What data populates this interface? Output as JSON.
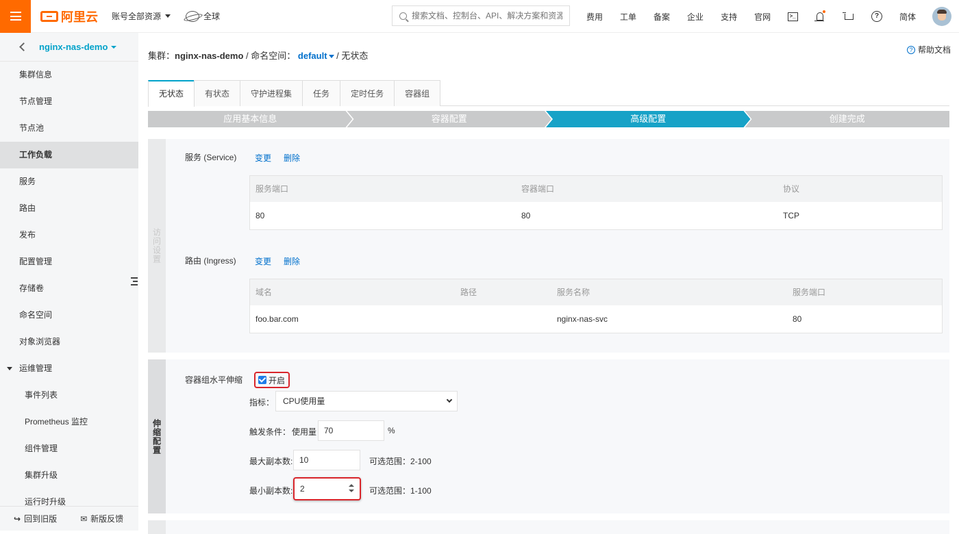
{
  "topbar": {
    "logo_text": "阿里云",
    "account_label": "账号全部资源",
    "region_label": "全球",
    "search_placeholder": "搜索文档、控制台、API、解决方案和资源",
    "nav_links": [
      "费用",
      "工单",
      "备案",
      "企业",
      "支持",
      "官网"
    ],
    "lang_label": "简体",
    "icons": [
      "terminal-icon",
      "bell-icon",
      "cart-icon",
      "help-icon"
    ],
    "notification_dot_color": "#ff6a00",
    "brand_color": "#ff6a00"
  },
  "sidebar": {
    "cluster_name": "nginx-nas-demo",
    "items": [
      {
        "label": "集群信息"
      },
      {
        "label": "节点管理"
      },
      {
        "label": "节点池"
      },
      {
        "label": "工作负载",
        "active": true
      },
      {
        "label": "服务"
      },
      {
        "label": "路由"
      },
      {
        "label": "发布"
      },
      {
        "label": "配置管理"
      },
      {
        "label": "存储卷"
      },
      {
        "label": "命名空间"
      },
      {
        "label": "对象浏览器"
      }
    ],
    "group": {
      "label": "运维管理",
      "expanded": true,
      "children": [
        "事件列表",
        "Prometheus 监控",
        "组件管理",
        "集群升级",
        "运行时升级"
      ]
    },
    "footer": {
      "back_old": "回到旧版",
      "feedback": "新版反馈"
    }
  },
  "main": {
    "breadcrumb": {
      "cluster_prefix": "集群：",
      "cluster": "nginx-nas-demo",
      "sep1": " / ",
      "ns_prefix": "命名空间：",
      "namespace": "default",
      "sep2": " / ",
      "current": "无状态"
    },
    "help_doc": "帮助文档",
    "tabs": [
      {
        "label": "无状态",
        "active": true
      },
      {
        "label": "有状态"
      },
      {
        "label": "守护进程集"
      },
      {
        "label": "任务"
      },
      {
        "label": "定时任务"
      },
      {
        "label": "容器组"
      }
    ],
    "steps": [
      {
        "label": "应用基本信息"
      },
      {
        "label": "容器配置"
      },
      {
        "label": "高级配置",
        "active": true
      },
      {
        "label": "创建完成"
      }
    ],
    "access_panel": {
      "side_label": "访问设置",
      "service": {
        "title": "服务 (Service)",
        "edit": "变更",
        "delete": "删除",
        "columns": [
          "服务端口",
          "容器端口",
          "协议"
        ],
        "rows": [
          [
            "80",
            "80",
            "TCP"
          ]
        ]
      },
      "ingress": {
        "title": "路由 (Ingress)",
        "edit": "变更",
        "delete": "删除",
        "columns": [
          "域名",
          "路径",
          "服务名称",
          "服务端口"
        ],
        "rows": [
          [
            "foo.bar.com",
            "",
            "nginx-nas-svc",
            "80"
          ]
        ]
      }
    },
    "scaling_panel": {
      "side_label": "伸缩配置",
      "hpa_label": "容器组水平伸缩",
      "enable_label": "开启",
      "enabled": true,
      "metric_label": "指标：",
      "metric_value": "CPU使用量",
      "trigger_label": "触发条件：",
      "trigger_sub": "使用量",
      "trigger_value": "70",
      "trigger_unit": "%",
      "max_label": "最大副本数:",
      "max_value": "10",
      "max_range": "可选范围：2-100",
      "min_label": "最小副本数:",
      "min_value": "2",
      "min_range": "可选范围：1-100",
      "highlight_color": "#d9252b"
    }
  }
}
